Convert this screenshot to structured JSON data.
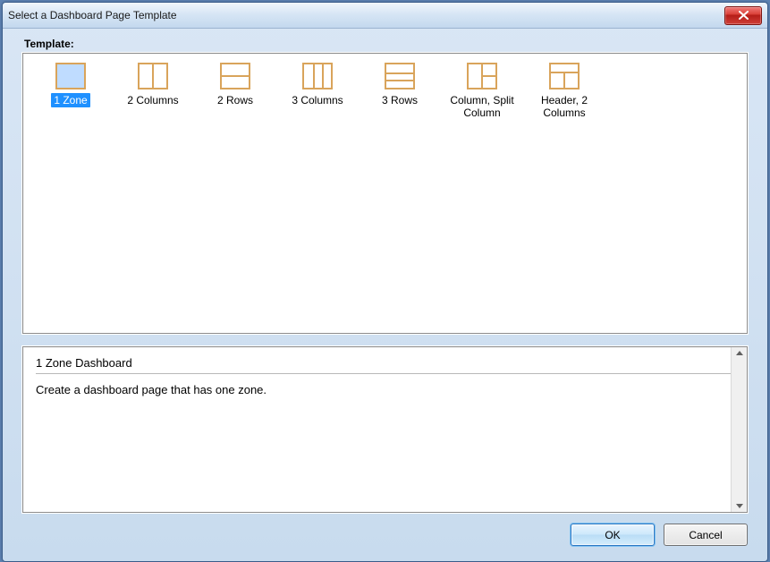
{
  "window": {
    "title": "Select a Dashboard Page Template"
  },
  "group_label": "Template:",
  "templates": [
    {
      "label": "1 Zone",
      "kind": "zone1",
      "selected": true
    },
    {
      "label": "2 Columns",
      "kind": "cols2",
      "selected": false
    },
    {
      "label": "2 Rows",
      "kind": "rows2",
      "selected": false
    },
    {
      "label": "3 Columns",
      "kind": "cols3",
      "selected": false
    },
    {
      "label": "3 Rows",
      "kind": "rows3",
      "selected": false
    },
    {
      "label": "Column, Split Column",
      "kind": "colsplit",
      "selected": false
    },
    {
      "label": "Header, 2 Columns",
      "kind": "head2c",
      "selected": false
    }
  ],
  "description": {
    "title": "1 Zone Dashboard",
    "text": "Create a dashboard page that has one zone."
  },
  "buttons": {
    "ok": "OK",
    "cancel": "Cancel"
  }
}
